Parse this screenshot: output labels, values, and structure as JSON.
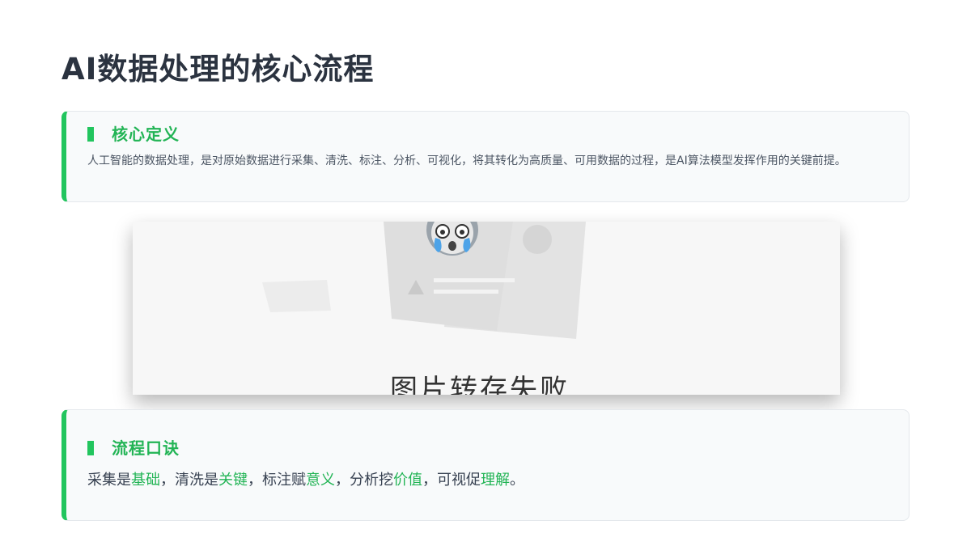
{
  "page": {
    "title": "AI数据处理的核心流程"
  },
  "definition": {
    "heading": "核心定义",
    "text": "人工智能的数据处理，是对原始数据进行采集、清洗、标注、分析、可视化，将其转化为高质量、可用数据的过程，是AI算法模型发挥作用的关键前提。"
  },
  "image": {
    "caption": "图片转存失败",
    "icon": "broken-image-icon"
  },
  "motto": {
    "heading": "流程口诀",
    "parts": {
      "p1": "采集是",
      "h1": "基础",
      "p2": "，清洗是",
      "h2": "关键",
      "p3": "，标注赋",
      "h3": "意义",
      "p4": "，分析挖",
      "h4": "价值",
      "p5": "，可视促",
      "h5": "理解",
      "p6": "。"
    }
  },
  "colors": {
    "accent": "#22c55e",
    "accent_text": "#22b455",
    "title": "#2b3340",
    "card_bg": "#f8fafb"
  }
}
